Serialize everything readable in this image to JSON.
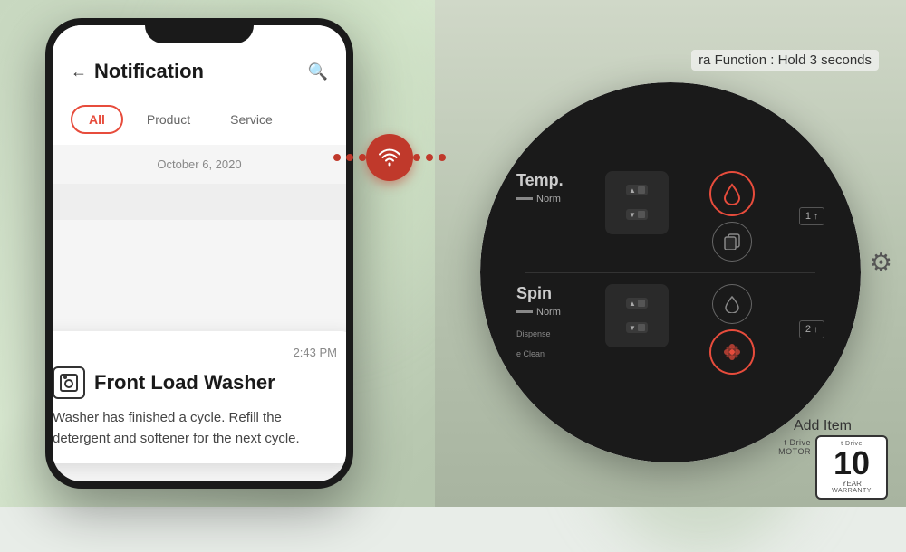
{
  "background": {
    "color": "#c8d8c0"
  },
  "phone": {
    "notification_screen": {
      "title": "Notification",
      "back_arrow": "←",
      "search_icon": "🔍",
      "tabs": [
        {
          "label": "All",
          "active": true
        },
        {
          "label": "Product",
          "active": false
        },
        {
          "label": "Service",
          "active": false
        }
      ],
      "date": "October 6, 2020",
      "card": {
        "time": "2:43 PM",
        "device_name": "Front Load Washer",
        "message": "Washer has finished a cycle. Refill the detergent and softener for the next cycle."
      }
    }
  },
  "wifi": {
    "icon": "📶"
  },
  "machine_panel": {
    "extra_function_label": "ra Function : Hold 3 seconds",
    "rows": [
      {
        "label": "Temp.",
        "norm_label": "Norm",
        "ctrl_up": "▲",
        "ctrl_down": "▼",
        "water_icon": "droplet",
        "copy_icon": "copy",
        "num": "1"
      },
      {
        "label": "Spin",
        "norm_label": "Norm",
        "ctrl_up": "▲",
        "ctrl_down": "▼",
        "water_icon": "droplet-outline",
        "spin_icon": "flower",
        "sub_label": "Dispense",
        "sub_label2": "e Clean",
        "num": "2"
      }
    ],
    "add_item": "Add Item",
    "gear_icon": "⚙",
    "warranty": {
      "top_text": "t Drive",
      "motor_text": "MOTOR",
      "number": "10",
      "year_text": "YEAR",
      "bottom_text": "WARRANTY"
    }
  }
}
